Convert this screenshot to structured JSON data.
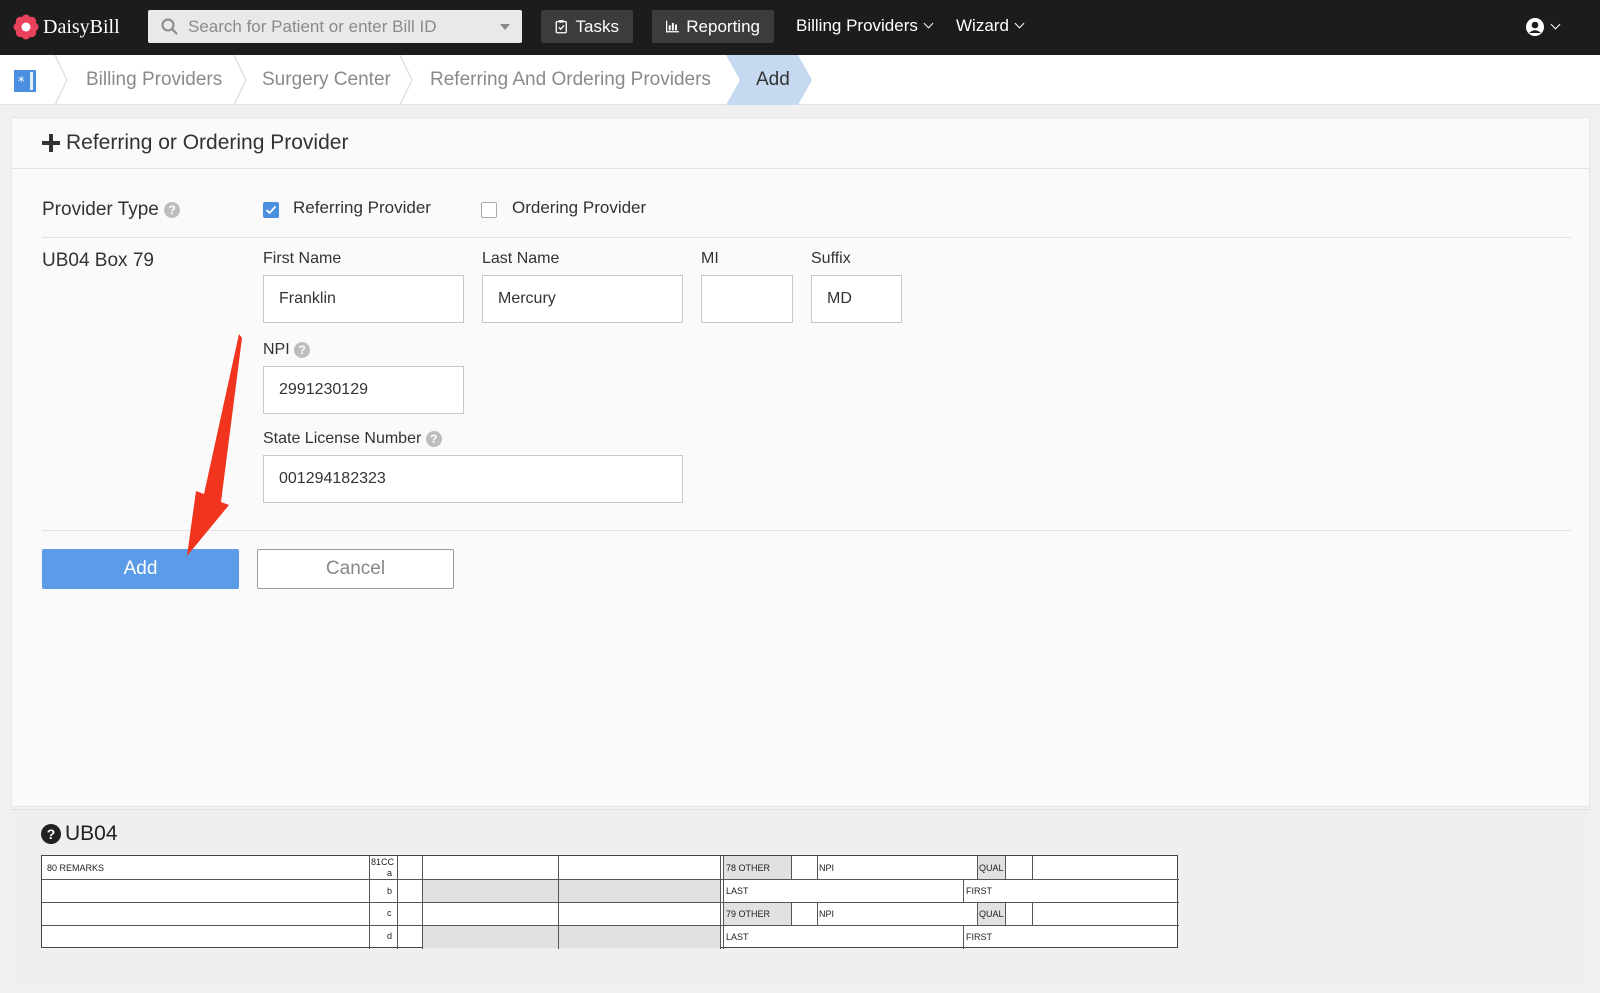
{
  "app": {
    "name": "DaisyBill"
  },
  "search": {
    "placeholder": "Search for Patient or enter Bill ID"
  },
  "nav": {
    "tasks": "Tasks",
    "reporting": "Reporting",
    "billing_providers": "Billing Providers",
    "wizard": "Wizard"
  },
  "breadcrumb": [
    "Billing Providers",
    "Surgery Center",
    "Referring And Ordering Providers",
    "Add"
  ],
  "form": {
    "title": "Referring or Ordering Provider",
    "provider_type_label": "Provider Type",
    "referring_label": "Referring Provider",
    "referring_checked": true,
    "ordering_label": "Ordering Provider",
    "ordering_checked": false,
    "box_label": "UB04 Box 79",
    "first_name_label": "First Name",
    "first_name": "Franklin",
    "last_name_label": "Last Name",
    "last_name": "Mercury",
    "mi_label": "MI",
    "mi": "",
    "suffix_label": "Suffix",
    "suffix": "MD",
    "npi_label": "NPI",
    "npi": "2991230129",
    "license_label": "State License Number",
    "license": "001294182323",
    "add_button": "Add",
    "cancel_button": "Cancel"
  },
  "ub04": {
    "title": "UB04",
    "remarks": "80 REMARKS",
    "cc": "81CC",
    "rows": [
      "a",
      "b",
      "c",
      "d"
    ],
    "other78": "78 OTHER",
    "other79": "79 OTHER",
    "npi": "NPI",
    "qual": "QUAL",
    "last": "LAST",
    "first": "FIRST"
  },
  "colors": {
    "accent": "#5b9be8",
    "topbar": "#1c1c1c",
    "annotation_arrow": "#f0341e"
  }
}
